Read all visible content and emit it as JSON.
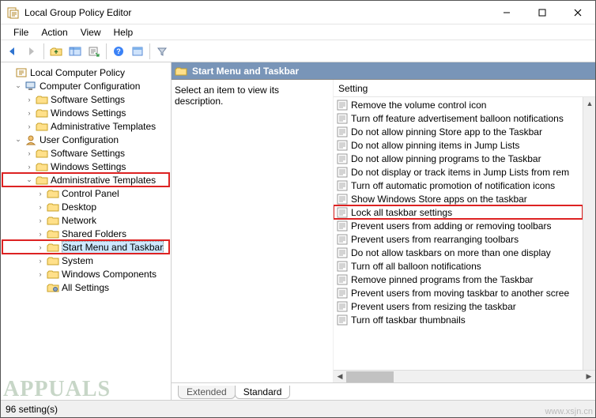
{
  "title": "Local Group Policy Editor",
  "menu": [
    "File",
    "Action",
    "View",
    "Help"
  ],
  "toolbar_icons": [
    "back",
    "forward",
    "up-folder",
    "show-pane",
    "export",
    "help",
    "properties",
    "filter"
  ],
  "tree": {
    "root": "Local Computer Policy",
    "computer_config": "Computer Configuration",
    "cc_children": [
      "Software Settings",
      "Windows Settings",
      "Administrative Templates"
    ],
    "user_config": "User Configuration",
    "uc_children": [
      "Software Settings",
      "Windows Settings"
    ],
    "admin_templates": "Administrative Templates",
    "at_children": [
      "Control Panel",
      "Desktop",
      "Network",
      "Shared Folders"
    ],
    "start_menu": "Start Menu and Taskbar",
    "after_sm": [
      "System",
      "Windows Components",
      "All Settings"
    ]
  },
  "settings_header": "Start Menu and Taskbar",
  "desc_hint": "Select an item to view its description.",
  "setting_col": "Setting",
  "settings_list": [
    "Remove the volume control icon",
    "Turn off feature advertisement balloon notifications",
    "Do not allow pinning Store app to the Taskbar",
    "Do not allow pinning items in Jump Lists",
    "Do not allow pinning programs to the Taskbar",
    "Do not display or track items in Jump Lists from rem",
    "Turn off automatic promotion of notification icons",
    "Show Windows Store apps on the taskbar",
    "Lock all taskbar settings",
    "Prevent users from adding or removing toolbars",
    "Prevent users from rearranging toolbars",
    "Do not allow taskbars on more than one display",
    "Turn off all balloon notifications",
    "Remove pinned programs from the Taskbar",
    "Prevent users from moving taskbar to another scree",
    "Prevent users from resizing the taskbar",
    "Turn off taskbar thumbnails"
  ],
  "highlight_index": 8,
  "tabs": {
    "extended": "Extended",
    "standard": "Standard"
  },
  "statusbar": "96 setting(s)",
  "watermark": "APPUALS",
  "site": "www.xsjn.cn"
}
